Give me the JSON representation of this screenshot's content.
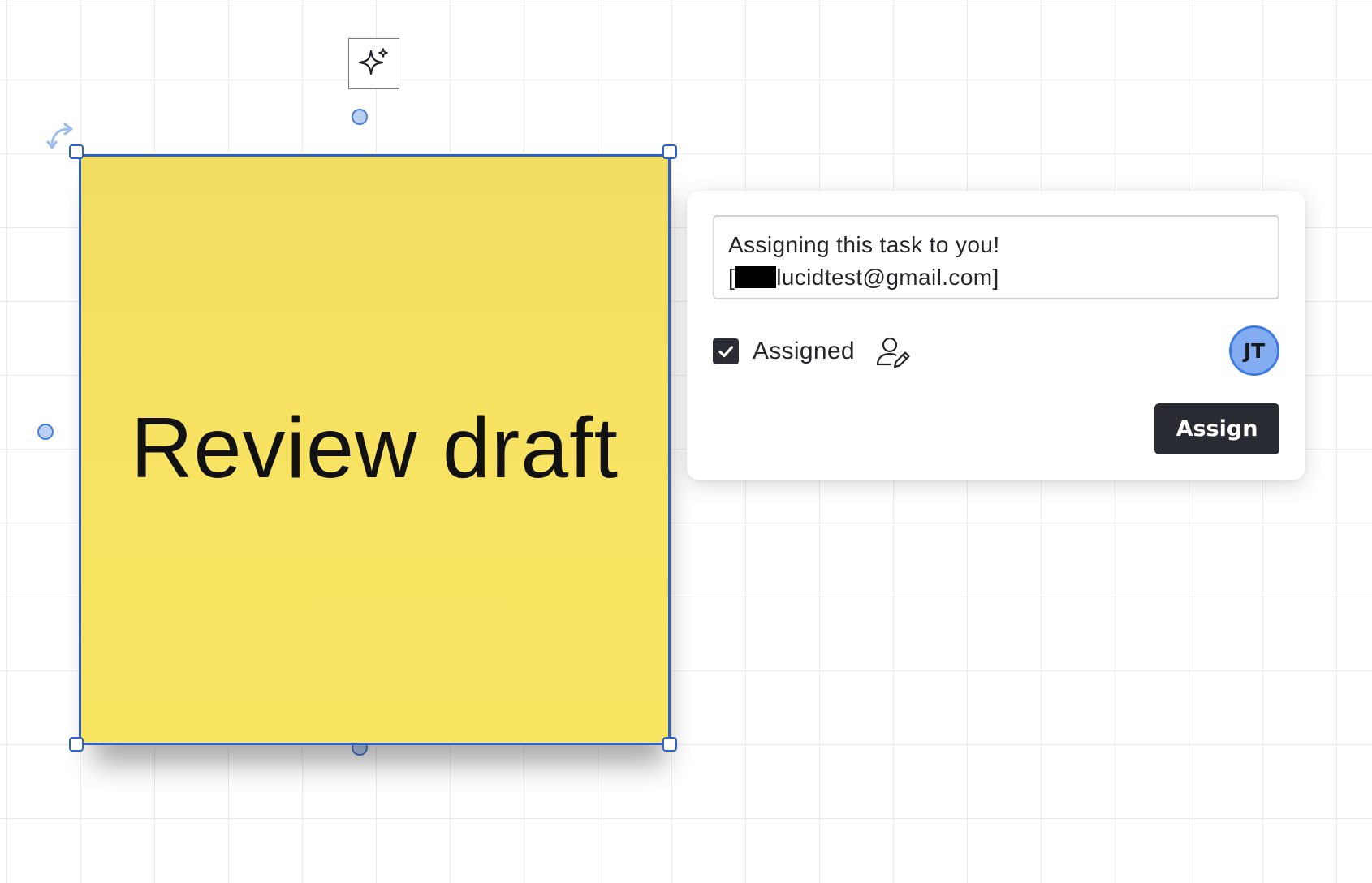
{
  "canvas": {
    "ai_button_icon": "sparkle-icon",
    "rotate_handle_icon": "rotate-icon",
    "selection_color": "#2f62c8"
  },
  "sticky_note": {
    "text": "Review draft",
    "fill_color": "#fae563"
  },
  "task_popover": {
    "message_line1": "Assigning this task to you!",
    "message_line2_open": "[",
    "message_line2_email": "lucidtest@gmail.com]",
    "assigned_checked": true,
    "assigned_label": "Assigned",
    "assignee_icon": "user-edit-icon",
    "avatar_initials": "JT",
    "avatar_color": "#83adf0",
    "assign_button_label": "Assign"
  }
}
